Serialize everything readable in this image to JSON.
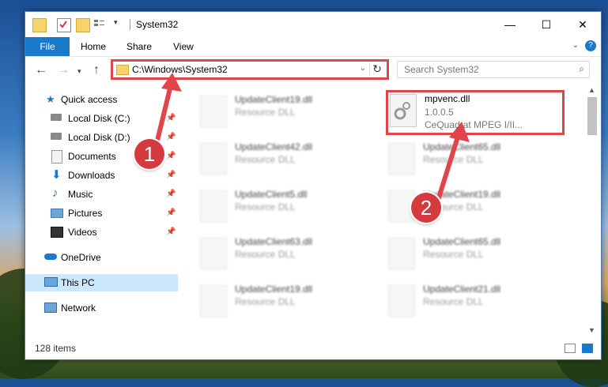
{
  "window": {
    "title": "System32",
    "controls": {
      "minimize": "—",
      "maximize": "☐",
      "close": "✕"
    }
  },
  "ribbon": {
    "tabs": [
      "File",
      "Home",
      "Share",
      "View"
    ],
    "help": "?"
  },
  "address": {
    "path": "C:\\Windows\\System32",
    "search_placeholder": "Search System32"
  },
  "sidebar": {
    "items": [
      {
        "label": "Quick access",
        "icon": "star-icon"
      },
      {
        "label": "Local Disk (C:)",
        "icon": "drive-icon"
      },
      {
        "label": "Local Disk (D:)",
        "icon": "drive-icon"
      },
      {
        "label": "Documents",
        "icon": "documents-icon"
      },
      {
        "label": "Downloads",
        "icon": "download-icon"
      },
      {
        "label": "Music",
        "icon": "music-icon"
      },
      {
        "label": "Pictures",
        "icon": "pictures-icon"
      },
      {
        "label": "Videos",
        "icon": "videos-icon"
      },
      {
        "label": "OneDrive",
        "icon": "cloud-icon"
      },
      {
        "label": "This PC",
        "icon": "computer-icon"
      },
      {
        "label": "Network",
        "icon": "network-icon"
      }
    ]
  },
  "files": [
    {
      "name": "UpdateClient19.dll",
      "desc": "Resource DLL"
    },
    {
      "name": "UpdateClient42.dll",
      "desc": "Resource DLL"
    },
    {
      "name": "UpdateClient5.dll",
      "desc": "Resource DLL"
    },
    {
      "name": "UpdateClient63.dll",
      "desc": "Resource DLL"
    },
    {
      "name": "UpdateClient19.dll",
      "desc": "Resource DLL"
    },
    {
      "name": "UpdateClient65.dll",
      "desc": "Resource DLL"
    },
    {
      "name": "UpdateClient19.dll",
      "desc": "Resource DLL"
    },
    {
      "name": "UpdateClient65.dll",
      "desc": "Resource DLL"
    },
    {
      "name": "UpdateClient21.dll",
      "desc": "Resource DLL"
    }
  ],
  "highlighted_file": {
    "name": "mpvenc.dll",
    "version": "1.0.0.5",
    "desc": "CeQuadrat MPEG I/II..."
  },
  "status": {
    "count": "128 items"
  },
  "callouts": [
    "1",
    "2"
  ],
  "colors": {
    "accent": "#1979ca",
    "highlight": "#e0454b",
    "selected": "#cce8ff"
  }
}
